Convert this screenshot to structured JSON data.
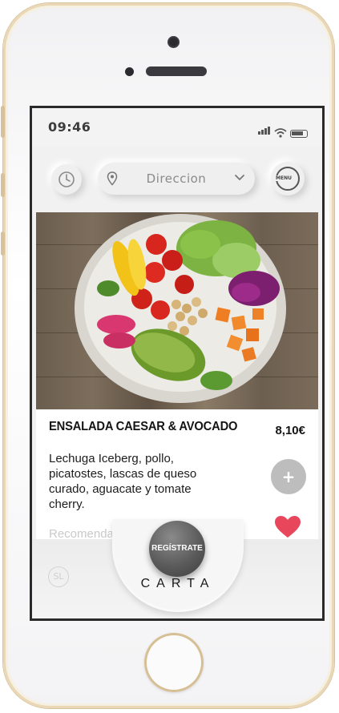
{
  "status_bar": {
    "time": "09:46"
  },
  "header": {
    "address_placeholder": "Direccion",
    "menu_label": "MENU"
  },
  "dish": {
    "title": "ENSALADA CAESAR & AVOCADO",
    "price": "8,10€",
    "description": "Lechuga Iceberg, pollo, picatostes, lascas de queso curado, aguacate y tomate cherry.",
    "recommendation": "Recomendamos … caesar",
    "add_symbol": "+"
  },
  "bottom_bar": {
    "badge": "SL",
    "register_label": "REGÍSTRATE",
    "carta_label": "CARTA"
  },
  "colors": {
    "heart": "#e8475b",
    "add_button": "#bdbdbd",
    "register_button": "#5b5b5b",
    "frame_gold": "#d9c29b"
  }
}
